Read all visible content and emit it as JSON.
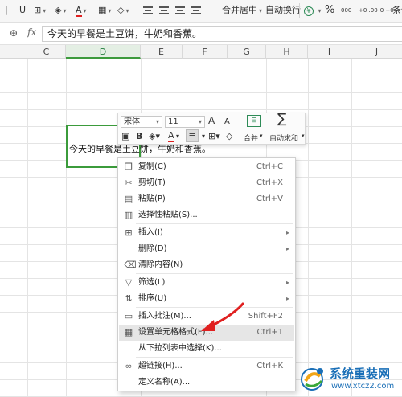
{
  "toolbar": {
    "underline": "U",
    "merge_center": "合并居中",
    "wrap_text": "自动换行",
    "percent": "%",
    "thousands": "000",
    "dec_inc": "+0 .00",
    "dec_dec": "-.0 +0",
    "cond_format": "条件"
  },
  "formula_bar": {
    "fx": "fx",
    "value": "今天的早餐是土豆饼，牛奶和香蕉。"
  },
  "columns": [
    "C",
    "D",
    "E",
    "F",
    "G",
    "H",
    "I",
    "J"
  ],
  "cell": {
    "text": "今天的早餐是土豆饼，牛奶和香蕉。"
  },
  "mini_toolbar": {
    "font_name": "宋体",
    "font_size": "11",
    "grow_font": "A",
    "shrink_font": "A",
    "bold": "B",
    "font_color": "A",
    "merge_label": "合并",
    "autosum_label": "自动求和",
    "sigma": "∑"
  },
  "context_menu": {
    "items": [
      {
        "label": "复制(C)",
        "shortcut": "Ctrl+C",
        "icon": "copy-icon",
        "glyph": "❐"
      },
      {
        "label": "剪切(T)",
        "shortcut": "Ctrl+X",
        "icon": "scissors-icon",
        "glyph": "✂"
      },
      {
        "label": "粘贴(P)",
        "shortcut": "Ctrl+V",
        "icon": "paste-icon",
        "glyph": "▤"
      },
      {
        "label": "选择性粘贴(S)...",
        "shortcut": "",
        "icon": "paste-special-icon",
        "glyph": "▥"
      },
      {
        "label": "插入(I)",
        "shortcut": "",
        "icon": "insert-icon",
        "glyph": "⊞"
      },
      {
        "label": "删除(D)",
        "shortcut": "",
        "icon": "",
        "glyph": ""
      },
      {
        "label": "清除内容(N)",
        "shortcut": "",
        "icon": "eraser-icon",
        "glyph": "⌫"
      },
      {
        "label": "筛选(L)",
        "shortcut": "",
        "icon": "filter-icon",
        "glyph": "▽"
      },
      {
        "label": "排序(U)",
        "shortcut": "",
        "icon": "sort-icon",
        "glyph": "⇅"
      },
      {
        "label": "插入批注(M)...",
        "shortcut": "Shift+F2",
        "icon": "comment-icon",
        "glyph": "▭"
      },
      {
        "label": "设置单元格格式(F)...",
        "shortcut": "Ctrl+1",
        "icon": "format-cells-icon",
        "glyph": "▦"
      },
      {
        "label": "从下拉列表中选择(K)...",
        "shortcut": "",
        "icon": "",
        "glyph": ""
      },
      {
        "label": "超链接(H)...",
        "shortcut": "Ctrl+K",
        "icon": "link-icon",
        "glyph": "∞"
      },
      {
        "label": "定义名称(A)...",
        "shortcut": "",
        "icon": "",
        "glyph": ""
      }
    ]
  },
  "watermark": {
    "title": "系统重装网",
    "url": "www.xtcz2.com"
  },
  "colors": {
    "selection_green": "#3b9b3b",
    "arrow_red": "#e02020",
    "watermark_blue": "#1a6fb7"
  }
}
